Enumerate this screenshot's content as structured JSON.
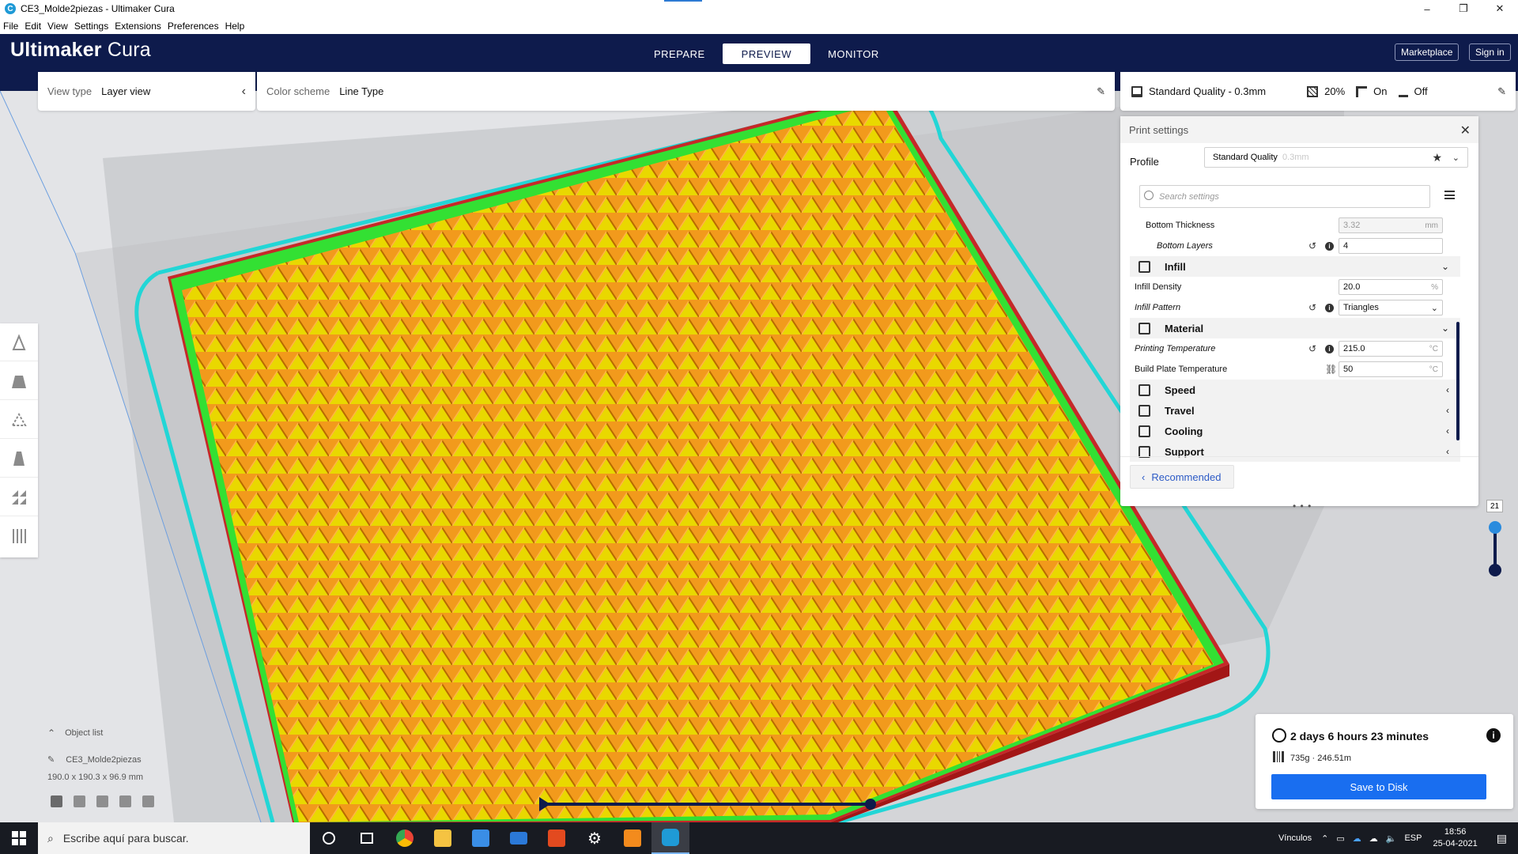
{
  "window": {
    "title": "CE3_Molde2piezas - Ultimaker Cura",
    "controls": [
      "–",
      "❐",
      "✕"
    ]
  },
  "menu": [
    "File",
    "Edit",
    "View",
    "Settings",
    "Extensions",
    "Preferences",
    "Help"
  ],
  "header": {
    "brand_bold": "Ultimaker",
    "brand_light": " Cura",
    "stages": [
      "PREPARE",
      "PREVIEW",
      "MONITOR"
    ],
    "active_stage": "PREVIEW",
    "marketplace": "Marketplace",
    "signin": "Sign in"
  },
  "view_panel": {
    "label": "View type",
    "value": "Layer view"
  },
  "color_panel": {
    "label": "Color scheme",
    "value": "Line Type"
  },
  "quality_panel": {
    "profile": "Standard Quality - 0.3mm",
    "infill": "20%",
    "support": "On",
    "adhesion": "Off"
  },
  "print_settings": {
    "title": "Print settings",
    "profile_label": "Profile",
    "profile_value": "Standard Quality",
    "profile_suffix": "0.3mm",
    "search_placeholder": "Search settings",
    "rows": [
      {
        "kind": "setting",
        "label": "Bottom Thickness",
        "value": "3.32",
        "unit": "mm",
        "indent": 2,
        "disabled": true
      },
      {
        "kind": "setting",
        "label": "Bottom Layers",
        "value": "4",
        "unit": "",
        "indent": 3,
        "italic": true,
        "reset": true
      },
      {
        "kind": "category",
        "label": "Infill",
        "expanded": true,
        "icon": "infill-icon"
      },
      {
        "kind": "setting",
        "label": "Infill Density",
        "value": "20.0",
        "unit": "%",
        "indent": 1
      },
      {
        "kind": "setting",
        "label": "Infill Pattern",
        "value": "Triangles",
        "unit": "",
        "indent": 1,
        "italic": true,
        "reset": true,
        "dropdown": true
      },
      {
        "kind": "category",
        "label": "Material",
        "expanded": true,
        "icon": "material-icon"
      },
      {
        "kind": "setting",
        "label": "Printing Temperature",
        "value": "215.0",
        "unit": "°C",
        "indent": 1,
        "italic": true,
        "reset": true
      },
      {
        "kind": "setting",
        "label": "Build Plate Temperature",
        "value": "50",
        "unit": "°C",
        "indent": 1,
        "link": true
      },
      {
        "kind": "category",
        "label": "Speed",
        "expanded": false,
        "icon": "speed-icon"
      },
      {
        "kind": "category",
        "label": "Travel",
        "expanded": false,
        "icon": "travel-icon"
      },
      {
        "kind": "category",
        "label": "Cooling",
        "expanded": false,
        "icon": "cooling-icon"
      },
      {
        "kind": "category",
        "label": "Support",
        "expanded": false,
        "icon": "support-icon"
      }
    ],
    "recommended": "Recommended"
  },
  "layer_slider": {
    "current_layer": "21"
  },
  "object_list": {
    "title": "Object list",
    "object_name": "CE3_Molde2piezas",
    "dimensions": "190.0 x 190.3 x 96.9 mm"
  },
  "estimate": {
    "time": "2 days 6 hours 23 minutes",
    "material": "735g · 246.51m",
    "save": "Save to Disk"
  },
  "taskbar": {
    "search_placeholder": "Escribe aquí para buscar.",
    "links": "Vínculos",
    "lang": "ESP",
    "time": "18:56",
    "date": "25-04-2021"
  },
  "colors": {
    "header": "#0e1b4c",
    "infill": "#f29a1c",
    "skin": "#f0e600",
    "wall_outer": "#c62828",
    "wall_inner": "#33e033",
    "skirt": "#22d6d6",
    "save_button": "#196ef0"
  }
}
